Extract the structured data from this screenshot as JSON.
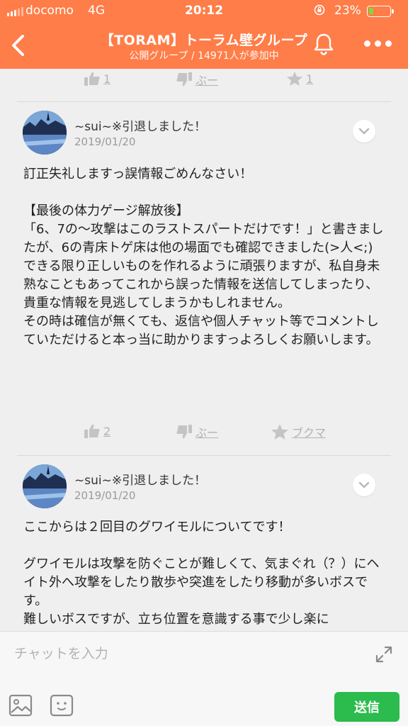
{
  "status_bar": {
    "carrier": "docomo",
    "network": "4G",
    "time": "20:12",
    "battery_percent": "23%",
    "battery_level": 0.23,
    "battery_color": "#7ddc3c"
  },
  "header": {
    "title": "【TORAM】トーラム壁グループ",
    "subtitle": "公開グループ / 14971人が参加中",
    "bg_color": "#ff7d48"
  },
  "top_reactions": {
    "like_count": "1",
    "boo_label": "ぶー",
    "star_count": "1"
  },
  "posts": [
    {
      "author": "~sui~※引退しました！",
      "date": "2019/01/20",
      "body": "訂正失礼しますっ誤情報ごめんなさい！\n\n【最後の体力ゲージ解放後】\n「6、7の〜攻撃はこのラストスパートだけです！」と書きましたが、6の青床トゲ床は他の場面でも確認できました(>人<;)\nできる限り正しいものを作れるように頑張りますが、私自身未熟なこともあってこれから誤った情報を送信してしまったり、貴重な情報を見逃してしまうかもしれません。\nその時は確信が無くても、返信や個人チャット等でコメントしていただけると本っ当に助かりますっよろしくお願いします。",
      "reactions": {
        "like_count": "2",
        "boo_label": "ぶー",
        "bookmark_label": "ブクマ"
      }
    },
    {
      "author": "~sui~※引退しました！",
      "date": "2019/01/20",
      "body": "ここからは２回目のグワイモルについてです！\n\nグワイモルは攻撃を防ぐことが難しくて、気まぐれ（？）にヘイト外へ攻撃をしたり散歩や突進をしたり移動が多いボスです。\n難しいボスですが、立ち位置を意識する事で少し楽に"
    }
  ],
  "chat": {
    "placeholder": "チャットを入力",
    "send_label": "送信",
    "send_color": "#2cbb4d"
  },
  "icons": [
    "back-icon",
    "bell-icon",
    "more-icon",
    "thumbs-up-icon",
    "thumbs-down-icon",
    "star-icon",
    "chevron-down-icon",
    "expand-icon",
    "image-icon",
    "emoji-icon"
  ]
}
